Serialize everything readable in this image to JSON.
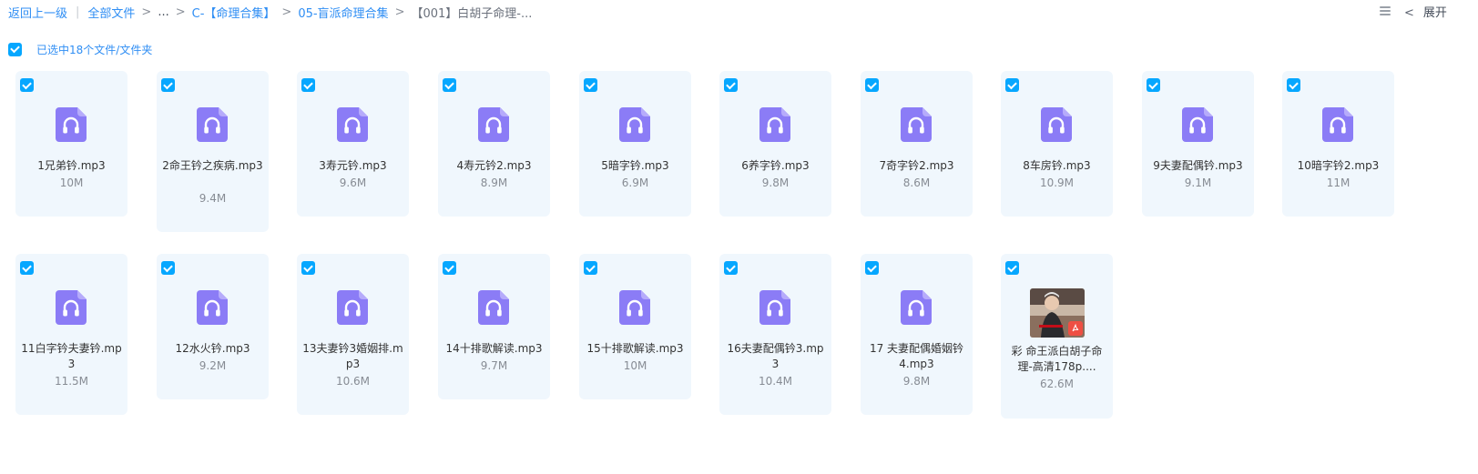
{
  "breadcrumb": {
    "back": "返回上一级",
    "all_files": "全部文件",
    "ellipsis": "...",
    "crumb1": "C-【命理合集】",
    "crumb2": "05-盲派命理合集",
    "current": "【001】白胡子命理-..."
  },
  "toolbar": {
    "collapse_label": "展开"
  },
  "selection": {
    "label": "已选中18个文件/文件夹"
  },
  "icons": {
    "audio": "headphones-icon",
    "pdf": "pdf-icon",
    "checkbox": "checkbox-checked-icon",
    "list_view": "list-view-icon",
    "chevron": "chevron-left-icon"
  },
  "colors": {
    "accent": "#06a7ff",
    "link": "#2f8ef4",
    "card_bg": "#f0f7fd",
    "audio_icon": "#8b7cf6"
  },
  "files": [
    {
      "name": "1兄弟钤.mp3",
      "size": "10M",
      "type": "audio"
    },
    {
      "name": "2命王钤之疾病.mp3",
      "size": "9.4M",
      "type": "audio"
    },
    {
      "name": "3寿元钤.mp3",
      "size": "9.6M",
      "type": "audio"
    },
    {
      "name": "4寿元钤2.mp3",
      "size": "8.9M",
      "type": "audio"
    },
    {
      "name": "5暗字钤.mp3",
      "size": "6.9M",
      "type": "audio"
    },
    {
      "name": "6养字钤.mp3",
      "size": "9.8M",
      "type": "audio"
    },
    {
      "name": "7奇字钤2.mp3",
      "size": "8.6M",
      "type": "audio"
    },
    {
      "name": "8车房钤.mp3",
      "size": "10.9M",
      "type": "audio"
    },
    {
      "name": "9夫妻配偶钤.mp3",
      "size": "9.1M",
      "type": "audio"
    },
    {
      "name": "10暗字钤2.mp3",
      "size": "11M",
      "type": "audio"
    },
    {
      "name": "11白字钤夫妻钤.mp3",
      "size": "11.5M",
      "type": "audio"
    },
    {
      "name": "12水火钤.mp3",
      "size": "9.2M",
      "type": "audio"
    },
    {
      "name": "13夫妻钤3婚姻排.mp3",
      "size": "10.6M",
      "type": "audio"
    },
    {
      "name": "14十排歌解读.mp3",
      "size": "9.7M",
      "type": "audio"
    },
    {
      "name": "15十排歌解读.mp3",
      "size": "10M",
      "type": "audio"
    },
    {
      "name": "16夫妻配偶钤3.mp3",
      "size": "10.4M",
      "type": "audio"
    },
    {
      "name": "17 夫妻配偶婚姻钤4.mp3",
      "size": "9.8M",
      "type": "audio"
    },
    {
      "name": "彩 命王派白胡子命理-高清178p....",
      "size": "62.6M",
      "type": "pdf"
    }
  ]
}
